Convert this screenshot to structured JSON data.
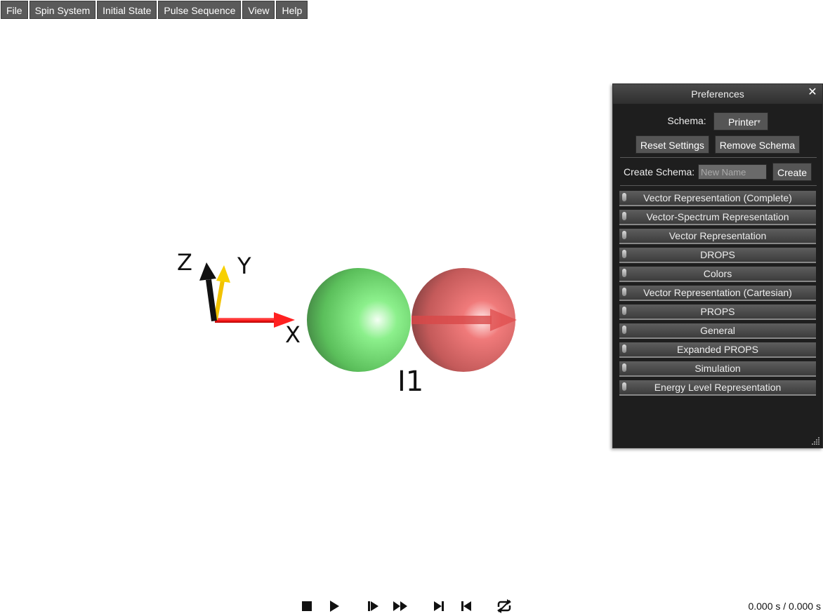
{
  "menubar": {
    "items": [
      "File",
      "Spin System",
      "Initial State",
      "Pulse Sequence",
      "View",
      "Help"
    ]
  },
  "scene": {
    "axes": {
      "x": "X",
      "y": "Y",
      "z": "Z"
    },
    "spin_label": "I1",
    "colors": {
      "x_axis": "#ff2a2a",
      "y_axis": "#f2c200",
      "z_axis": "#111111",
      "sphere_left": "#66e066",
      "sphere_right": "#e06464"
    }
  },
  "preferences": {
    "title": "Preferences",
    "schema_label": "Schema:",
    "schema_value": "Printer",
    "reset_label": "Reset Settings",
    "remove_label": "Remove Schema",
    "create_label": "Create Schema:",
    "create_placeholder": "New Name",
    "create_button": "Create",
    "sections": [
      "Vector Representation (Complete)",
      "Vector-Spectrum Representation",
      "Vector Representation",
      "DROPS",
      "Colors",
      "Vector Representation (Cartesian)",
      "PROPS",
      "General",
      "Expanded PROPS",
      "Simulation",
      "Energy Level Representation"
    ]
  },
  "playback": {
    "time": "0.000 s / 0.000 s"
  }
}
